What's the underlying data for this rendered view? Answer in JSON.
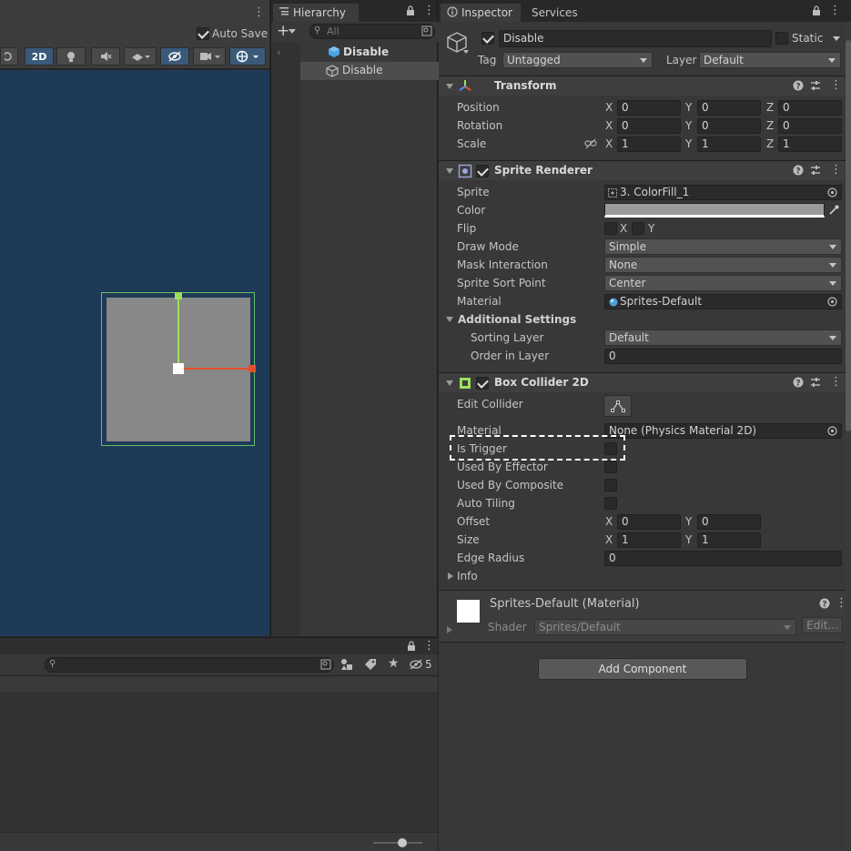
{
  "scene": {
    "auto_save_label": "Auto Save",
    "btn_2d": "2D"
  },
  "hierarchy": {
    "tab_label": "Hierarchy",
    "search_placeholder": "All",
    "scene_name": "Disable",
    "object_name": "Disable"
  },
  "inspector": {
    "tab_label": "Inspector",
    "services_tab": "Services",
    "object_name": "Disable",
    "static_label": "Static",
    "tag_label": "Tag",
    "tag_value": "Untagged",
    "layer_label": "Layer",
    "layer_value": "Default",
    "transform": {
      "title": "Transform",
      "rows": [
        {
          "label": "Position",
          "x": "0",
          "y": "0",
          "z": "0"
        },
        {
          "label": "Rotation",
          "x": "0",
          "y": "0",
          "z": "0"
        },
        {
          "label": "Scale",
          "x": "1",
          "y": "1",
          "z": "1"
        }
      ]
    },
    "sprite_renderer": {
      "title": "Sprite Renderer",
      "sprite_label": "Sprite",
      "sprite_value": "3. ColorFill_1",
      "color_label": "Color",
      "flip_label": "Flip",
      "flip_x": "X",
      "flip_y": "Y",
      "draw_mode_label": "Draw Mode",
      "draw_mode_value": "Simple",
      "mask_label": "Mask Interaction",
      "mask_value": "None",
      "sort_point_label": "Sprite Sort Point",
      "sort_point_value": "Center",
      "material_label": "Material",
      "material_value": "Sprites-Default",
      "additional_label": "Additional Settings",
      "sorting_layer_label": "Sorting Layer",
      "sorting_layer_value": "Default",
      "order_label": "Order in Layer",
      "order_value": "0"
    },
    "box_collider": {
      "title": "Box Collider 2D",
      "edit_collider_label": "Edit Collider",
      "material_label": "Material",
      "material_value": "None (Physics Material 2D)",
      "is_trigger_label": "Is Trigger",
      "used_by_effector_label": "Used By Effector",
      "used_by_composite_label": "Used By Composite",
      "auto_tiling_label": "Auto Tiling",
      "offset_label": "Offset",
      "offset_x": "0",
      "offset_y": "0",
      "size_label": "Size",
      "size_x": "1",
      "size_y": "1",
      "edge_radius_label": "Edge Radius",
      "edge_radius_value": "0",
      "info_label": "Info"
    },
    "material_section": {
      "name": "Sprites-Default (Material)",
      "shader_label": "Shader",
      "shader_value": "Sprites/Default",
      "edit_button": "Edit..."
    },
    "add_component": "Add Component",
    "axis_x": "X",
    "axis_y": "Y",
    "axis_z": "Z"
  },
  "project": {
    "hidden_count": "5"
  },
  "colors": {
    "scene_bg": "#1f3a57",
    "sprite_gray": "#888888",
    "accent_green": "#9be05a",
    "accent_red": "#e4502d",
    "selected_row": "#4d4d4d"
  }
}
